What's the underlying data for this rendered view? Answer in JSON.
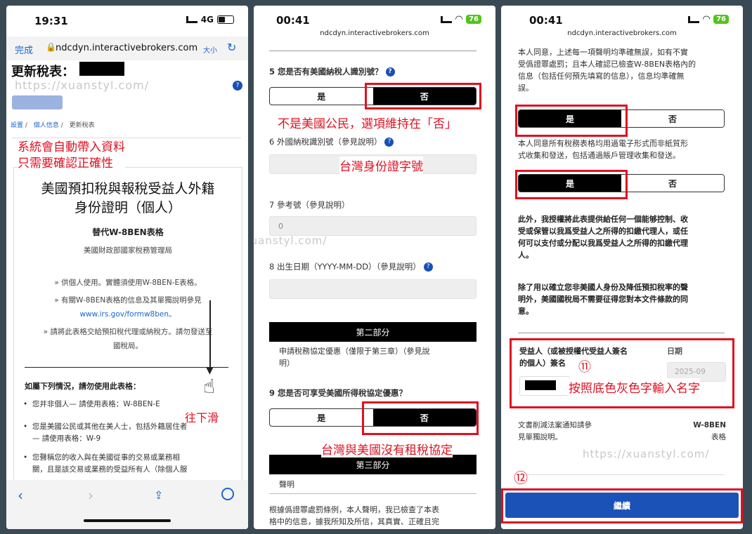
{
  "watermark": "https://xuanstyl.com/",
  "p1": {
    "time": "19:31",
    "net": "4G",
    "done": "完成",
    "url": "ndcdyn.interactivebrokers.com",
    "textsize": "大小",
    "title": "更新稅表：",
    "help": "?",
    "breadcrumb": [
      "設置",
      "個人信息",
      "更新稅表"
    ],
    "annot": [
      "系統會自動帶入資料",
      "只需要確認正確性"
    ],
    "form_title": [
      "美國預扣稅與報稅受益人外籍",
      "身份證明（個人）"
    ],
    "subtitle": "替代W-8BEN表格",
    "agency": "美國財政部國家稅務管理局",
    "bullets": [
      "» 供個人使用。實體須使用W-8BEN-E表格。",
      "» 有關W-8BEN表格的信息及其單獨說明參見",
      "www.irs.gov/formw8ben。",
      "» 請將此表格交給預扣稅代理或納稅方。請勿發送至",
      "國稅局。"
    ],
    "scroll_annot": "往下滑",
    "list_head": "如屬下列情況，請勿使用此表格：",
    "items": [
      [
        "您并非個人— 請使用表格：W-8BEN-E"
      ],
      [
        "您是美國公民或其他在美人士，包括外籍居住者",
        "— 請使用表格：W-9"
      ],
      [
        "您聲稱您的收入與在美國從事的交易或業務相",
        "關，且是該交易或業務的受益所有人（除個人服"
      ]
    ]
  },
  "p2": {
    "time": "00:41",
    "battery": "76",
    "url": "ndcdyn.interactivebrokers.com",
    "q5": "5  您是否有美國納稅人識別號？",
    "yes": "是",
    "no": "否",
    "annot1": "不是美國公民，選項維持在「否」",
    "q6": "6 外國納稅識別號（參見說明）",
    "annot2": "台灣身份證字號",
    "q7": "7 參考號（參見說明）",
    "ref": "0",
    "q8": "8 出生日期（YYYY-MM-DD）（參見說明）",
    "part2": "第二部分",
    "part2_desc": [
      "申請稅務協定優惠（僅限于第三章）（參見說",
      "明）"
    ],
    "q9": "9  您是否可享受美國所得稅協定優惠？",
    "annot3": "台灣與美國沒有租稅協定",
    "part3": "第三部分",
    "decl": "聲明",
    "decl_text": [
      "根據僞證罪處罰條例，本人聲明，我已檢查了本表",
      "格中的信息，據我所知及所信，其真實、正確且完"
    ]
  },
  "p3": {
    "time": "00:41",
    "battery": "76",
    "url": "ndcdyn.interactivebrokers.com",
    "text1": [
      "本人同意，上述每一項聲明均準確無誤，如有不實",
      "受僞證罪處罰；且本人確認已檢查W-8BEN表格內的",
      "信息（包括任何預先填寫的信息），信息均準確無",
      "誤。"
    ],
    "yes": "是",
    "no": "否",
    "text2": [
      "本人同意所有稅務表格均用過電子形式而非紙質形",
      "式收集和發送，包括通過賬戶管理收集和發送。"
    ],
    "text3": [
      "此外，我授權將此表提供給任何一個能够控制、收",
      "受或保管以我爲受益人之所得的扣繳代理人，或任",
      "何可以支付或分配以我爲受益人之所得的扣繳代理",
      "人。"
    ],
    "text4": [
      "除了用以確立您非美國人身份及降低預扣稅率的聲",
      "明外，美國國稅局不需要征得您對本文件條款的同",
      "意。"
    ],
    "sig_label": [
      "受益人（或被授權代受益人簽名",
      "的個人）簽名"
    ],
    "num11": "⑪",
    "date_label": "日期",
    "date_value": "2025-09",
    "annot": "按照底色灰色字輸入名字",
    "notice": [
      "文書削減法案通知請參",
      "見單獨說明。"
    ],
    "form": [
      "W-8BEN",
      "表格"
    ],
    "num12": "⑫",
    "continue": "繼續"
  }
}
